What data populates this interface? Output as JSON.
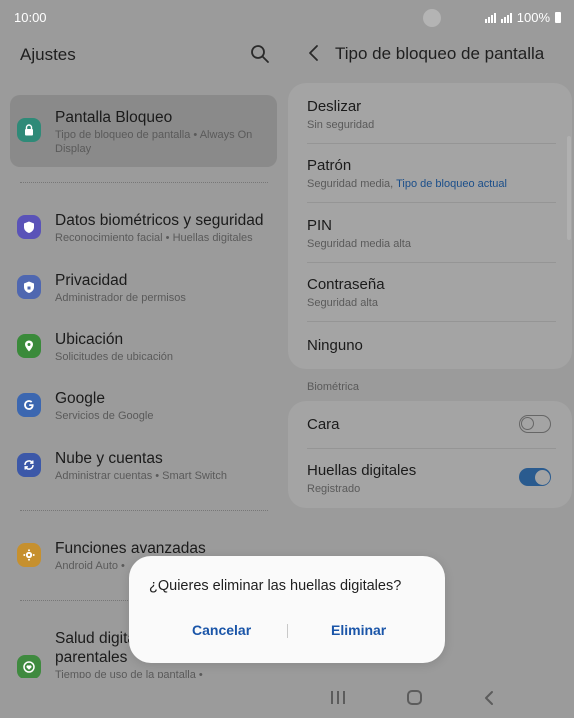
{
  "status_bar": {
    "time": "10:00",
    "battery": "100%"
  },
  "left": {
    "title": "Ajustes",
    "items": [
      {
        "title": "Pantalla Bloqueo",
        "subtitle": "Tipo de bloqueo de pantalla  •  Always On Display",
        "icon": "lock-icon",
        "color": "#2f8a78",
        "selected": true
      },
      {
        "title": "Datos biométricos y seguridad",
        "subtitle": "Reconocimiento facial  •  Huellas digitales",
        "icon": "shield-icon",
        "color": "#5a53b8"
      },
      {
        "title": "Privacidad",
        "subtitle": "Administrador de permisos",
        "icon": "privacy-shield-icon",
        "color": "#4f67b0"
      },
      {
        "title": "Ubicación",
        "subtitle": "Solicitudes de ubicación",
        "icon": "location-pin-icon",
        "color": "#3a8a3a"
      },
      {
        "title": "Google",
        "subtitle": "Servicios de Google",
        "icon": "google-icon",
        "color": "#3c67b0"
      },
      {
        "title": "Nube y cuentas",
        "subtitle": "Administrar cuentas  •  Smart Switch",
        "icon": "sync-icon",
        "color": "#3c58a8"
      },
      {
        "title": "Funciones avanzadas",
        "subtitle": "Android Auto  •  ",
        "icon": "puzzle-gear-icon",
        "color": "#c6902e"
      },
      {
        "title": "Salud digital y controles parentales",
        "title_line1": "Salud digita",
        "title_line2": "parentales",
        "subtitle": "Tiempo de uso de la pantalla  •",
        "icon": "digital-wellbeing-icon",
        "color": "#3f8a3f"
      }
    ]
  },
  "right": {
    "title": "Tipo de bloqueo de pantalla",
    "options": [
      {
        "title": "Deslizar",
        "subtitle": "Sin seguridad"
      },
      {
        "title": "Patrón",
        "subtitle": "Seguridad media, ",
        "subtitle_highlight": "Tipo de bloqueo actual"
      },
      {
        "title": "PIN",
        "subtitle": "Seguridad media alta"
      },
      {
        "title": "Contraseña",
        "subtitle": "Seguridad alta"
      },
      {
        "title": "Ninguno",
        "subtitle": ""
      }
    ],
    "biometric_section": "Biométrica",
    "biometrics": [
      {
        "title": "Cara",
        "subtitle": "",
        "enabled": false
      },
      {
        "title": "Huellas digitales",
        "subtitle": "Registrado",
        "enabled": true
      }
    ]
  },
  "dialog": {
    "question": "¿Quieres eliminar las huellas digitales?",
    "cancel": "Cancelar",
    "confirm": "Eliminar"
  },
  "colors": {
    "accent": "#1a55a8",
    "toggle_on": "#2a5b8f"
  }
}
